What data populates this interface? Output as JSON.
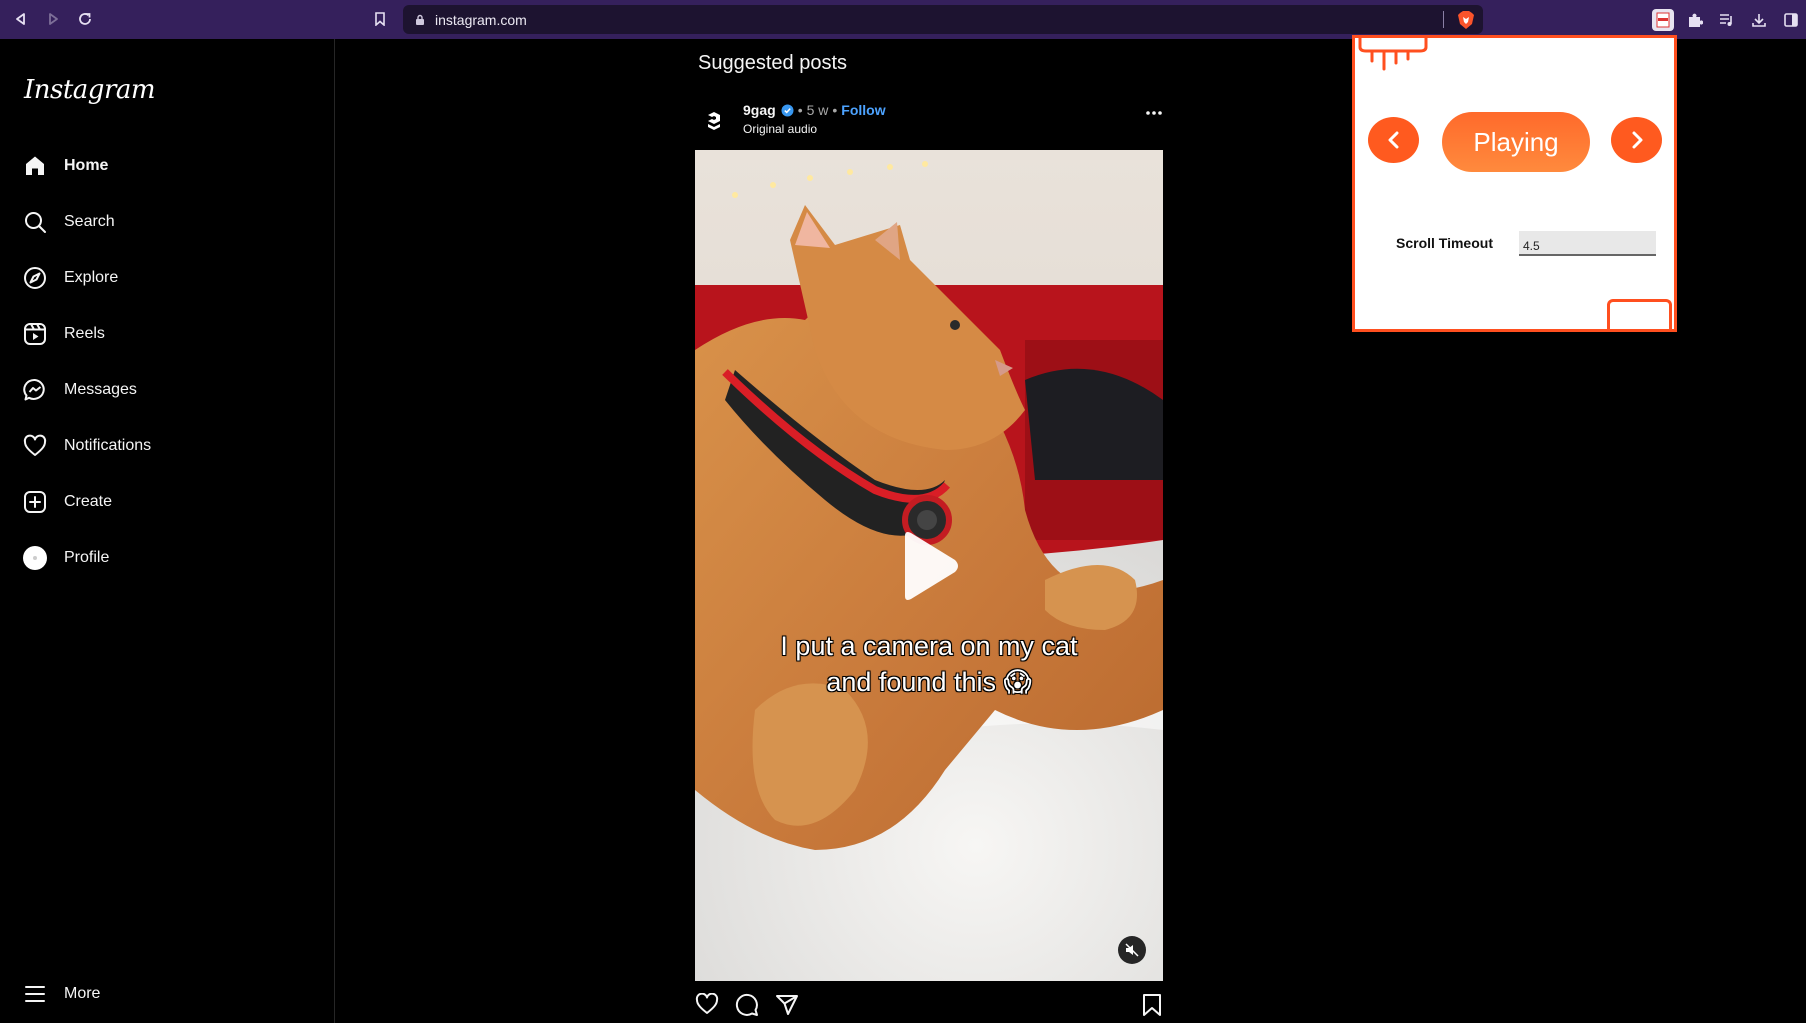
{
  "browser": {
    "url": "instagram.com",
    "icons": [
      "back-icon",
      "forward-icon",
      "reload-icon",
      "bookmark-icon",
      "lock-icon",
      "brave-shield-icon",
      "extension-active-icon",
      "puzzle-icon",
      "playlist-icon",
      "download-icon",
      "sidebar-icon"
    ]
  },
  "sidebar": {
    "logo": "Instagram",
    "items": [
      {
        "label": "Home",
        "icon": "home-icon"
      },
      {
        "label": "Search",
        "icon": "search-icon"
      },
      {
        "label": "Explore",
        "icon": "compass-icon"
      },
      {
        "label": "Reels",
        "icon": "reels-icon"
      },
      {
        "label": "Messages",
        "icon": "messenger-icon"
      },
      {
        "label": "Notifications",
        "icon": "heart-icon"
      },
      {
        "label": "Create",
        "icon": "plus-square-icon"
      },
      {
        "label": "Profile",
        "icon": "profile-avatar"
      }
    ],
    "more": "More"
  },
  "feed": {
    "title": "Suggested posts",
    "post": {
      "account": "9gag",
      "time": "5 w",
      "separator": "•",
      "follow_label": "Follow",
      "audio": "Original audio",
      "caption_line1": "I put a camera on my cat",
      "caption_line2": "and found this 😱"
    }
  },
  "popup": {
    "play_label": "Playing",
    "timeout_label": "Scroll Timeout",
    "timeout_value": "4.5",
    "accent": "#ff5a1f"
  }
}
